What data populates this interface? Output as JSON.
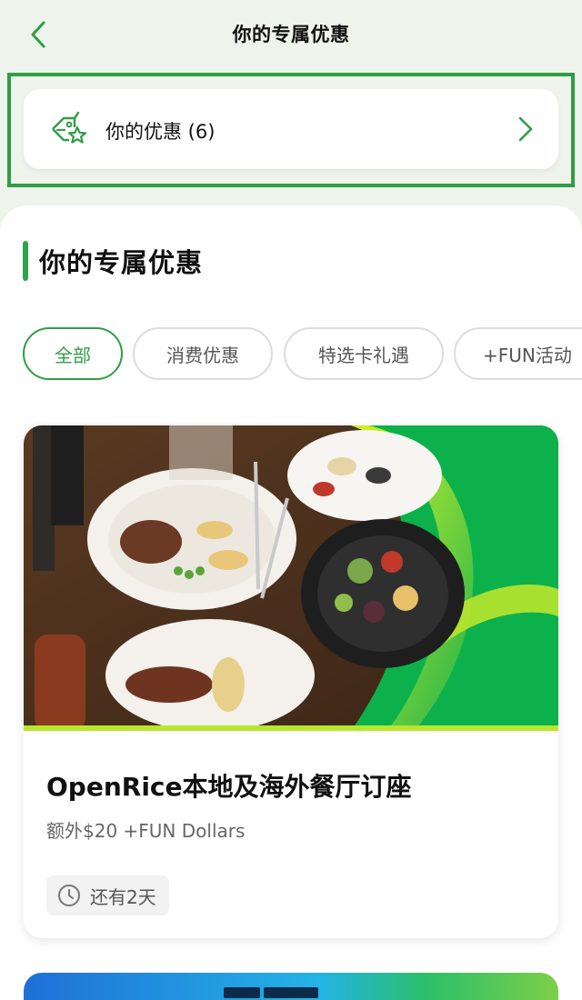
{
  "header": {
    "title": "你的专属优惠"
  },
  "coupon_entry": {
    "label": "你的优惠 (6)"
  },
  "section": {
    "title": "你的专属优惠"
  },
  "filters": [
    {
      "label": "全部",
      "active": true
    },
    {
      "label": "消费优惠",
      "active": false
    },
    {
      "label": "特选卡礼遇",
      "active": false
    },
    {
      "label": "+FUN活动",
      "active": false
    }
  ],
  "offers": [
    {
      "title": "OpenRice本地及海外餐厅订座",
      "subtitle": "额外$20 +FUN Dollars",
      "remaining": "还有2天"
    }
  ],
  "colors": {
    "accent": "#2f9e44",
    "background": "#eef4ec",
    "card_green": "#0db14b"
  }
}
